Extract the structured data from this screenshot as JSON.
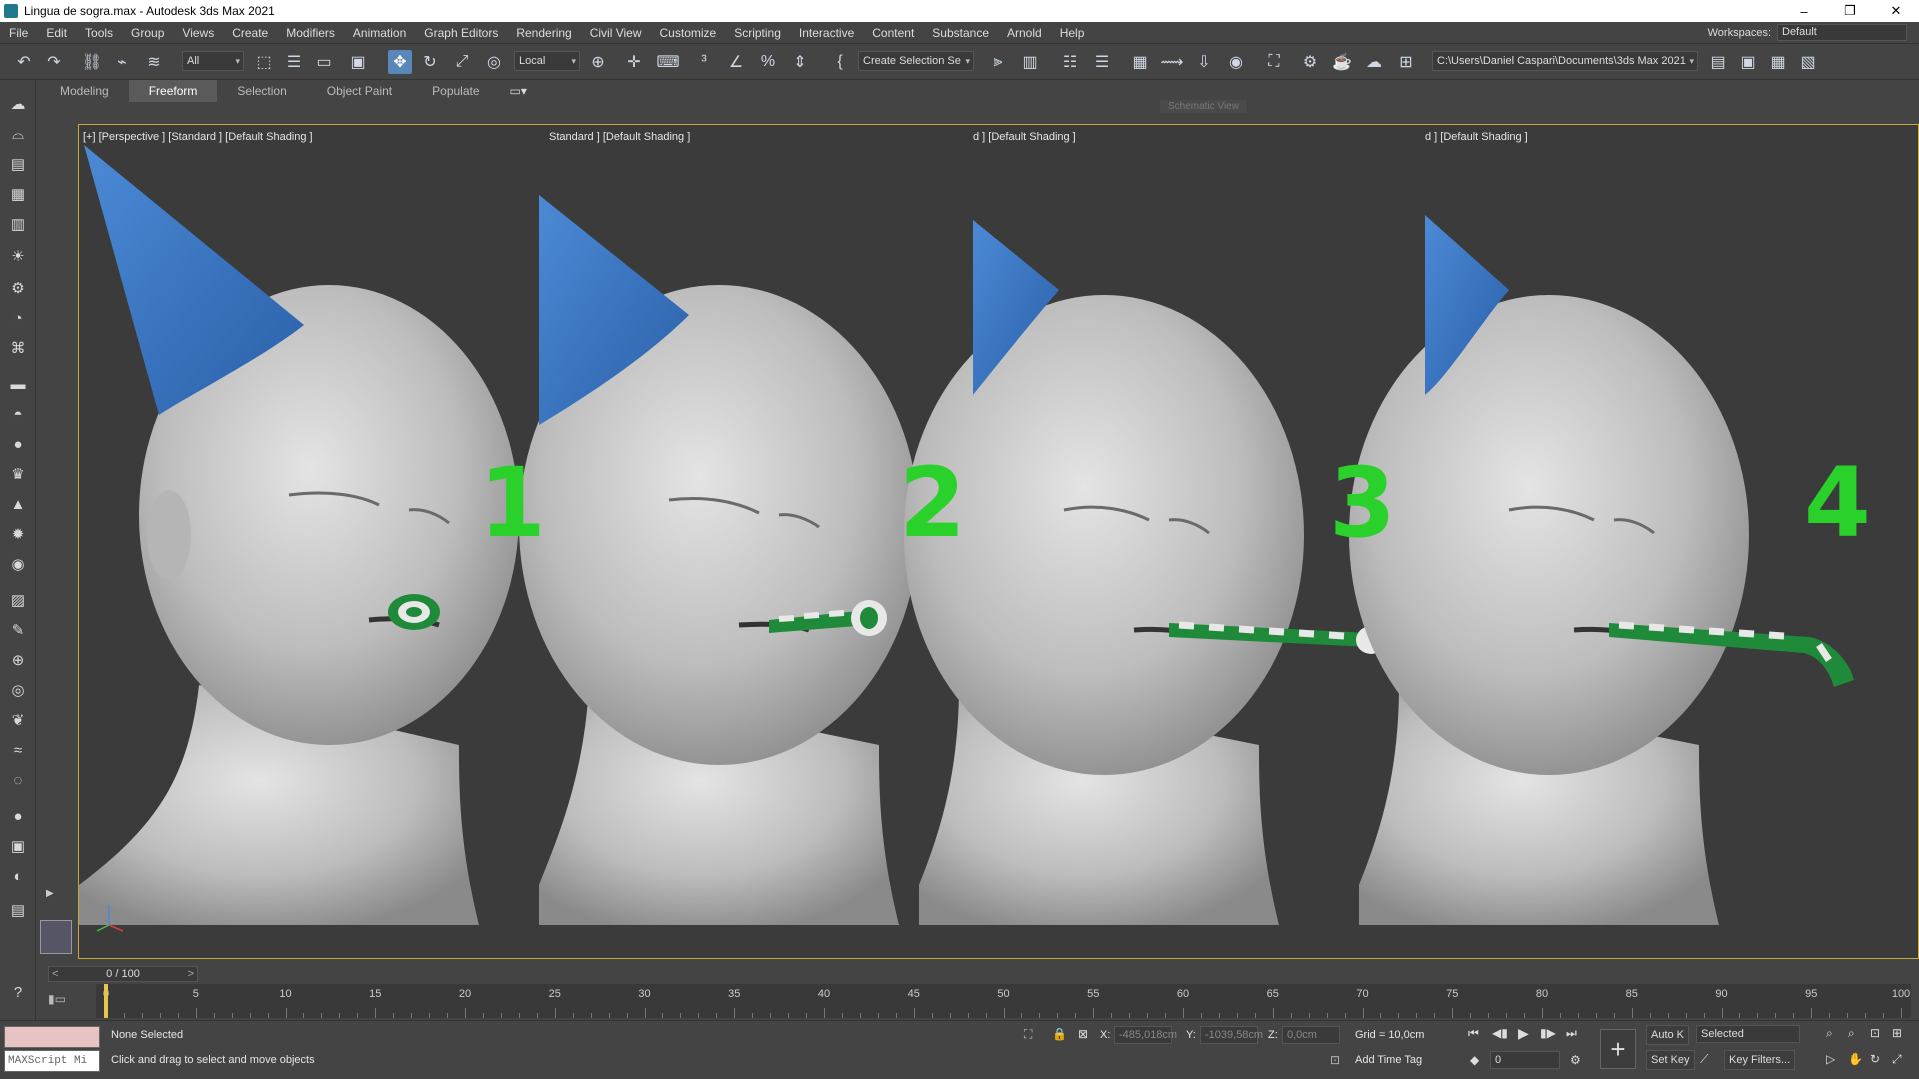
{
  "window": {
    "title": "Lingua de sogra.max - Autodesk 3ds Max 2021",
    "controls": [
      "–",
      "❐",
      "✕"
    ]
  },
  "menu": {
    "items": [
      "File",
      "Edit",
      "Tools",
      "Group",
      "Views",
      "Create",
      "Modifiers",
      "Animation",
      "Graph Editors",
      "Rendering",
      "Civil View",
      "Customize",
      "Scripting",
      "Interactive",
      "Content",
      "Substance",
      "Arnold",
      "Help"
    ],
    "workspaces_label": "Workspaces:",
    "workspace_value": "Default"
  },
  "toolbar": {
    "filter_value": "All",
    "coord_value": "Local",
    "selection_set_value": "Create Selection Se",
    "path_value": "C:\\Users\\Daniel Caspari\\Documents\\3ds Max 2021"
  },
  "ribbon": {
    "tabs": [
      "Modeling",
      "Freeform",
      "Selection",
      "Object Paint",
      "Populate"
    ],
    "active_tab": "Freeform",
    "hint": "Schematic View"
  },
  "viewport": {
    "labels": [
      "[+] [Perspective ] [Standard ] [Default Shading ]",
      "Standard ] [Default Shading ]",
      "d ] [Default Shading ]",
      "d ] [Default Shading ]"
    ],
    "numbers": [
      "1",
      "2",
      "3",
      "4"
    ],
    "colors": {
      "hat": "#3a78c4",
      "head": "#c8c8c8",
      "stripe_green": "#1e8a3a",
      "label_green": "#2bd12b",
      "viewport_bg": "#3b3b3b"
    }
  },
  "timeline": {
    "frame_display": "0 / 100",
    "ticks": [
      "0",
      "5",
      "10",
      "15",
      "20",
      "25",
      "30",
      "35",
      "40",
      "45",
      "50",
      "55",
      "60",
      "65",
      "70",
      "75",
      "80",
      "85",
      "90",
      "95",
      "100"
    ]
  },
  "status": {
    "maxscript_placeholder": "MAXScript Mi",
    "selection": "None Selected",
    "prompt": "Click and drag to select and move objects",
    "x_label": "X:",
    "x_value": "-485,018cm",
    "y_label": "Y:",
    "y_value": "-1039,58cm",
    "z_label": "Z:",
    "z_value": "0,0cm",
    "grid": "Grid = 10,0cm",
    "add_time_tag": "Add Time Tag",
    "auto_key": "Auto K",
    "selected_value": "Selected",
    "set_key": "Set Key",
    "key_filters": "Key Filters...",
    "frame_value": "0"
  }
}
